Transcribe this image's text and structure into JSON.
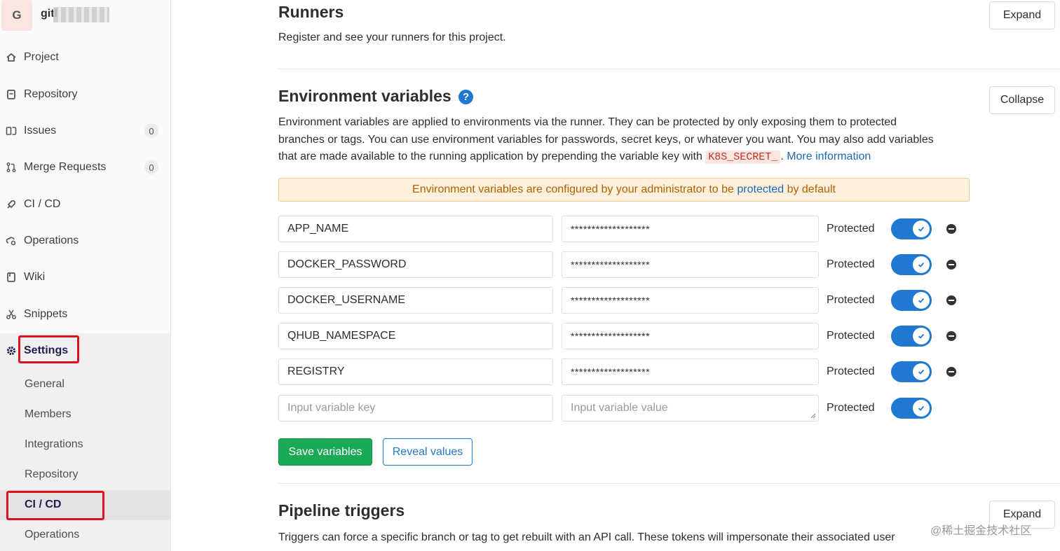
{
  "project": {
    "avatar_letter": "G",
    "name": "gitl"
  },
  "sidebar": {
    "items": [
      {
        "label": "Project",
        "icon": "home-icon"
      },
      {
        "label": "Repository",
        "icon": "document-icon"
      },
      {
        "label": "Issues",
        "icon": "issues-icon",
        "count": "0"
      },
      {
        "label": "Merge Requests",
        "icon": "merge-request-icon",
        "count": "0"
      },
      {
        "label": "CI / CD",
        "icon": "rocket-icon"
      },
      {
        "label": "Operations",
        "icon": "cloud-gear-icon"
      },
      {
        "label": "Wiki",
        "icon": "book-icon"
      },
      {
        "label": "Snippets",
        "icon": "scissors-icon"
      },
      {
        "label": "Settings",
        "icon": "gear-icon"
      }
    ],
    "settings_sub": [
      "General",
      "Members",
      "Integrations",
      "Repository",
      "CI / CD",
      "Operations"
    ]
  },
  "runners": {
    "title": "Runners",
    "desc": "Register and see your runners for this project.",
    "button": "Expand"
  },
  "env": {
    "title": "Environment variables",
    "help_icon": "?",
    "button": "Collapse",
    "desc_line1": "Environment variables are applied to environments via the runner. They can be protected by only exposing them to protected",
    "desc_line2": "branches or tags. You can use environment variables for passwords, secret keys, or whatever you want. You may also add variables",
    "desc_line3_pre": "that are made available to the running application by prepending the variable key with ",
    "desc_code": "K8S_SECRET_",
    "desc_line3_post": ". ",
    "more_info": "More information",
    "warning_pre": "Environment variables are configured by your administrator to be ",
    "warning_link": "protected",
    "warning_post": " by default",
    "rows": [
      {
        "key": "APP_NAME",
        "value": "*******************",
        "protected": "Protected"
      },
      {
        "key": "DOCKER_PASSWORD",
        "value": "*******************",
        "protected": "Protected"
      },
      {
        "key": "DOCKER_USERNAME",
        "value": "*******************",
        "protected": "Protected"
      },
      {
        "key": "QHUB_NAMESPACE",
        "value": "*******************",
        "protected": "Protected"
      },
      {
        "key": "REGISTRY",
        "value": "*******************",
        "protected": "Protected"
      }
    ],
    "new_row": {
      "key_placeholder": "Input variable key",
      "value_placeholder": "Input variable value",
      "protected": "Protected"
    },
    "save_button": "Save variables",
    "reveal_button": "Reveal values"
  },
  "triggers": {
    "title": "Pipeline triggers",
    "desc": "Triggers can force a specific branch or tag to get rebuilt with an API call. These tokens will impersonate their associated user",
    "button": "Expand"
  },
  "watermark": "@稀土掘金技术社区",
  "colors": {
    "accent": "#1f78d1",
    "success": "#1aaa55",
    "highlight": "#e0101e",
    "warning_bg": "#fdf1dd"
  }
}
